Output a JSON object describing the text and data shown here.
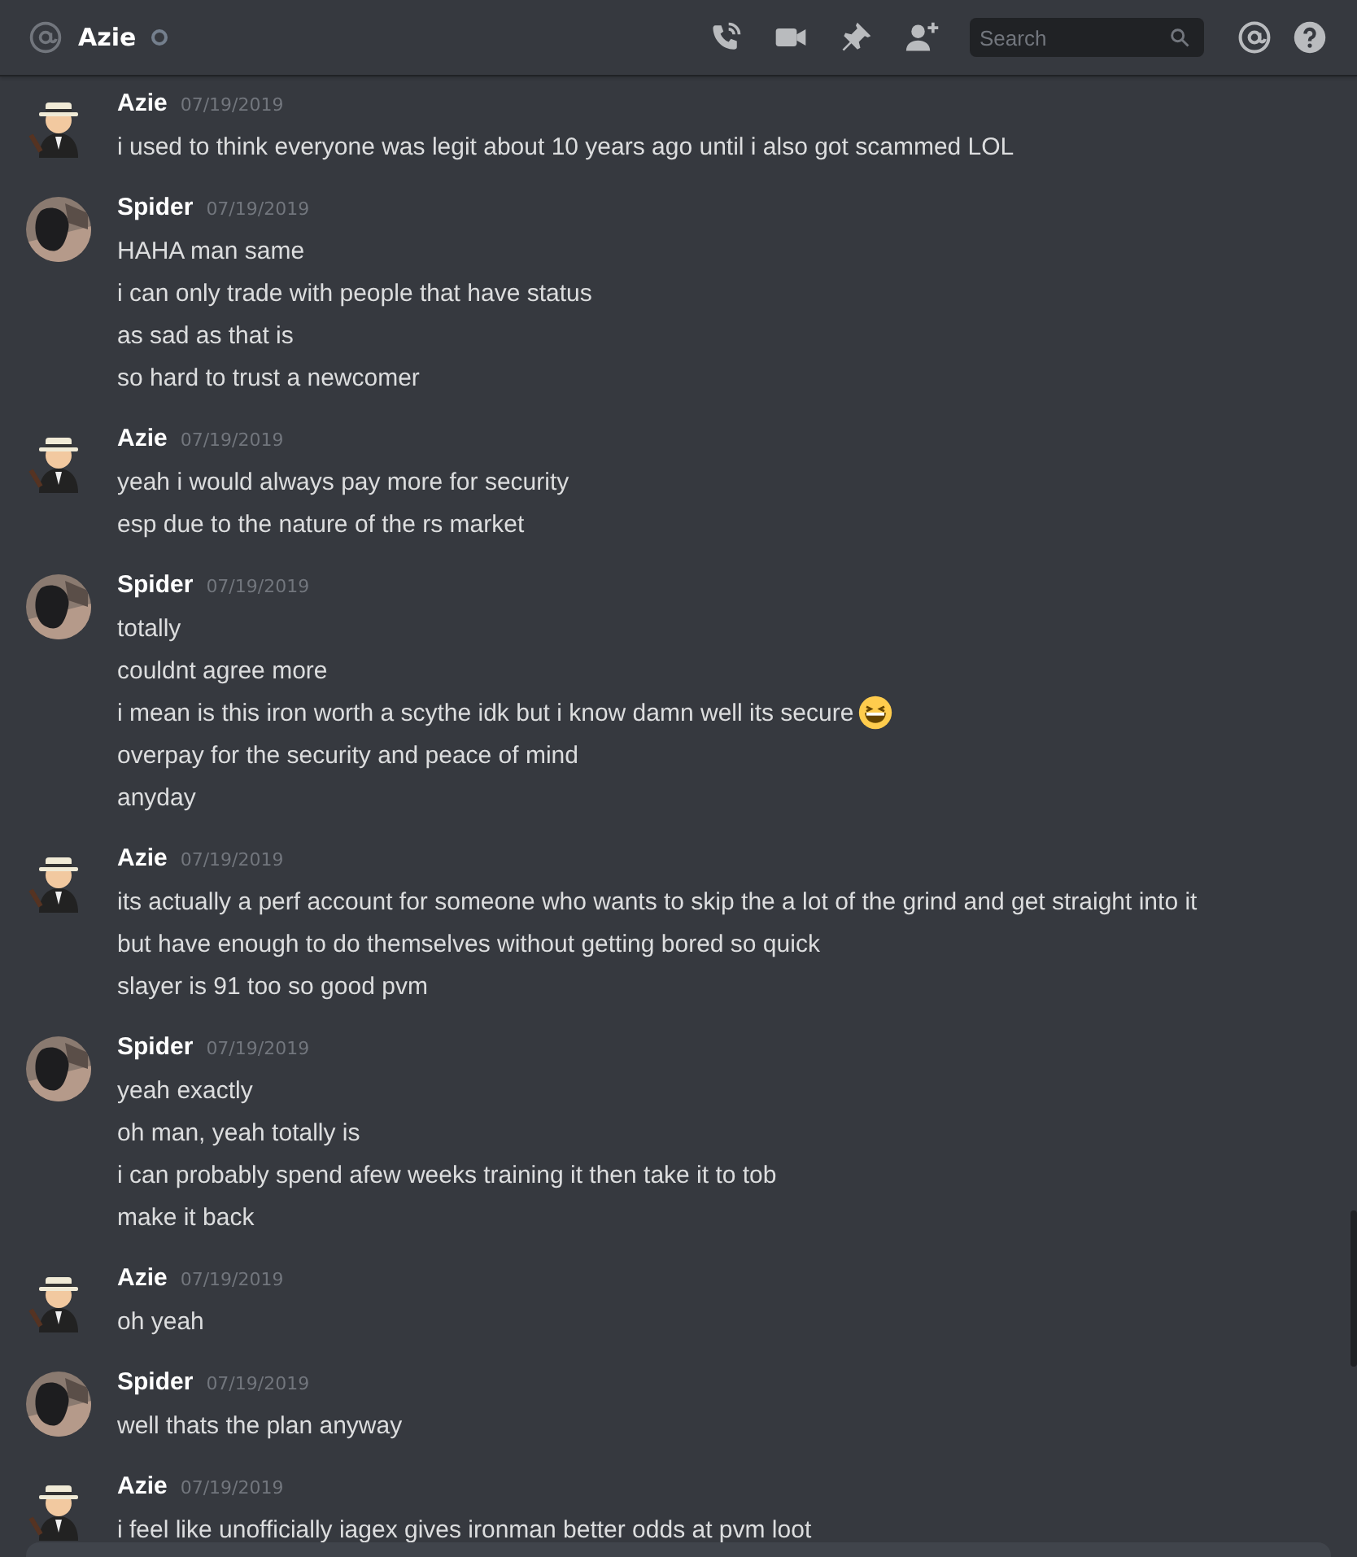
{
  "header": {
    "name": "Azie",
    "online": false,
    "search": {
      "placeholder": "Search"
    }
  },
  "groups": [
    {
      "author": "Azie",
      "kind": "figure",
      "time": "07/19/2019",
      "lines": [
        {
          "text": "i used to think everyone was legit about 10 years ago until i also got scammed LOL",
          "emoji": false
        }
      ]
    },
    {
      "author": "Spider",
      "kind": "photo",
      "time": "07/19/2019",
      "lines": [
        {
          "text": "HAHA man same",
          "emoji": false
        },
        {
          "text": "i can only trade with people that have status",
          "emoji": false
        },
        {
          "text": "as sad as that is",
          "emoji": false
        },
        {
          "text": "so hard to trust a newcomer",
          "emoji": false
        }
      ]
    },
    {
      "author": "Azie",
      "kind": "figure",
      "time": "07/19/2019",
      "lines": [
        {
          "text": "yeah i would always pay more for security",
          "emoji": false
        },
        {
          "text": "esp due to the nature of the rs market",
          "emoji": false
        }
      ]
    },
    {
      "author": "Spider",
      "kind": "photo",
      "time": "07/19/2019",
      "lines": [
        {
          "text": "totally",
          "emoji": false
        },
        {
          "text": "couldnt agree more",
          "emoji": false
        },
        {
          "text": "i mean is this iron worth a scythe idk but i know damn well its secure",
          "emoji": true
        },
        {
          "text": "overpay for the security and peace of mind",
          "emoji": false
        },
        {
          "text": "anyday",
          "emoji": false
        }
      ]
    },
    {
      "author": "Azie",
      "kind": "figure",
      "time": "07/19/2019",
      "lines": [
        {
          "text": "its actually a perf account for someone who wants to skip the a lot of the grind and get straight into it",
          "emoji": false
        },
        {
          "text": "but have enough to do themselves without getting bored so quick",
          "emoji": false
        },
        {
          "text": "slayer is 91 too so good pvm",
          "emoji": false
        }
      ]
    },
    {
      "author": "Spider",
      "kind": "photo",
      "time": "07/19/2019",
      "lines": [
        {
          "text": "yeah exactly",
          "emoji": false
        },
        {
          "text": "oh man, yeah totally is",
          "emoji": false
        },
        {
          "text": "i can probably spend afew weeks training it then take it to tob",
          "emoji": false
        },
        {
          "text": "make it back",
          "emoji": false
        }
      ]
    },
    {
      "author": "Azie",
      "kind": "figure",
      "time": "07/19/2019",
      "lines": [
        {
          "text": "oh yeah",
          "emoji": false
        }
      ]
    },
    {
      "author": "Spider",
      "kind": "photo",
      "time": "07/19/2019",
      "lines": [
        {
          "text": "well thats the plan anyway",
          "emoji": false
        }
      ]
    },
    {
      "author": "Azie",
      "kind": "figure",
      "time": "07/19/2019",
      "lines": [
        {
          "text": "i feel like unofficially iagex gives ironman better odds at pvm loot",
          "emoji": false
        }
      ]
    }
  ]
}
